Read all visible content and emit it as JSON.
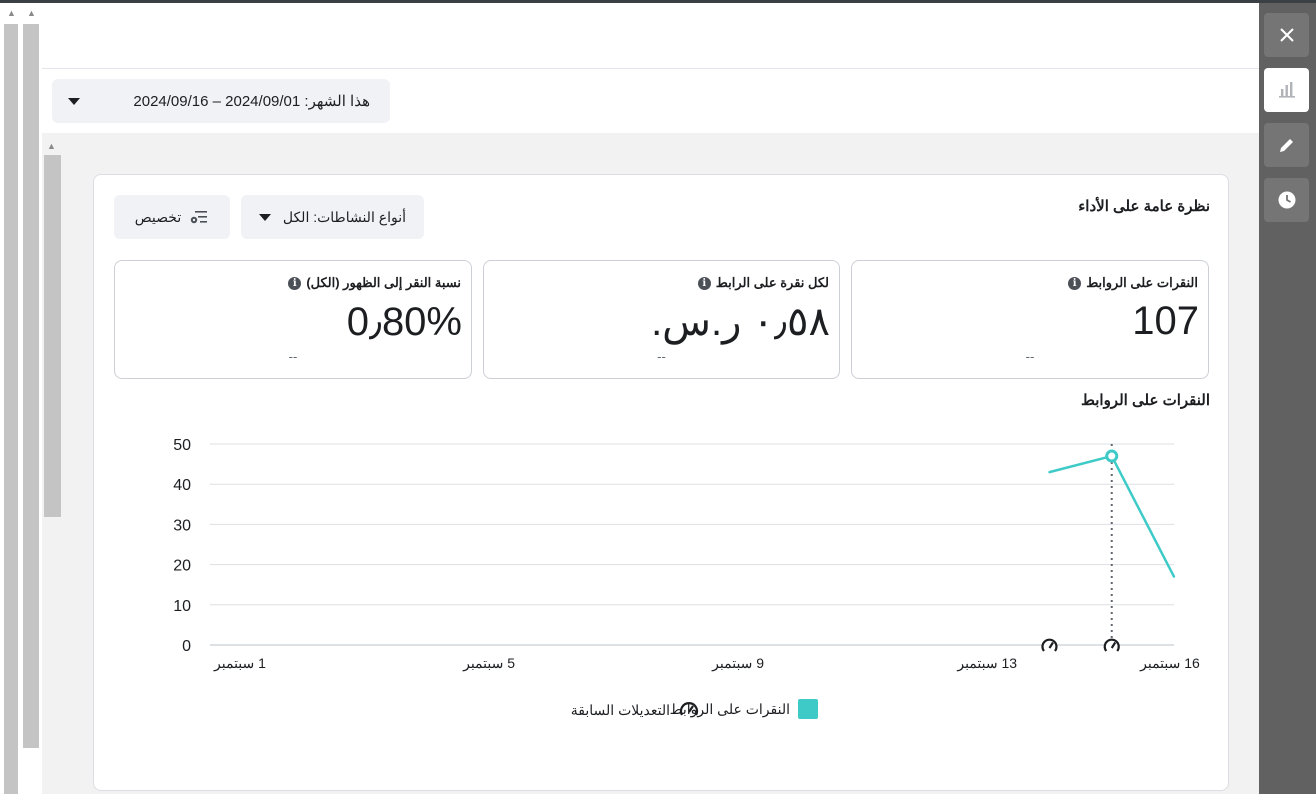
{
  "date_range": {
    "label": "هذا الشهر: 2024/09/01 – 2024/09/16"
  },
  "overview": {
    "title": "نظرة عامة على الأداء",
    "activity_filter": "أنواع النشاطات: الكل",
    "customize": "تخصيص"
  },
  "metrics": [
    {
      "label": "النقرات على الروابط",
      "value": "107",
      "change": "--"
    },
    {
      "label": "لكل نقرة على الرابط",
      "value": "٠٫٥٨ ر.س.",
      "change": "--"
    },
    {
      "label": "نسبة النقر إلى الظهور (الكل)",
      "value": "0٫80%",
      "change": "--"
    }
  ],
  "chart_data": {
    "type": "line",
    "title": "النقرات على الروابط",
    "x_ticks": [
      "1 سبتمبر",
      "5 سبتمبر",
      "9 سبتمبر",
      "13 سبتمبر",
      "16 سبتمبر"
    ],
    "x_tick_days": [
      1,
      5,
      9,
      13,
      16
    ],
    "xlim": [
      1,
      16
    ],
    "ylim": [
      0,
      50
    ],
    "y_ticks": [
      0,
      10,
      20,
      30,
      40,
      50
    ],
    "series": [
      {
        "name": "النقرات على الروابط",
        "color": "#3ecbc8",
        "x": [
          14,
          15,
          16
        ],
        "y": [
          43,
          47,
          17
        ],
        "highlight_x": 15
      }
    ],
    "edit_markers_x": [
      14,
      15
    ],
    "legend": [
      "النقرات على الروابط",
      "التعديلات السابقة"
    ],
    "grid": true
  },
  "side_icons": [
    "close-icon",
    "bar-chart-icon",
    "pencil-icon",
    "clock-icon"
  ]
}
